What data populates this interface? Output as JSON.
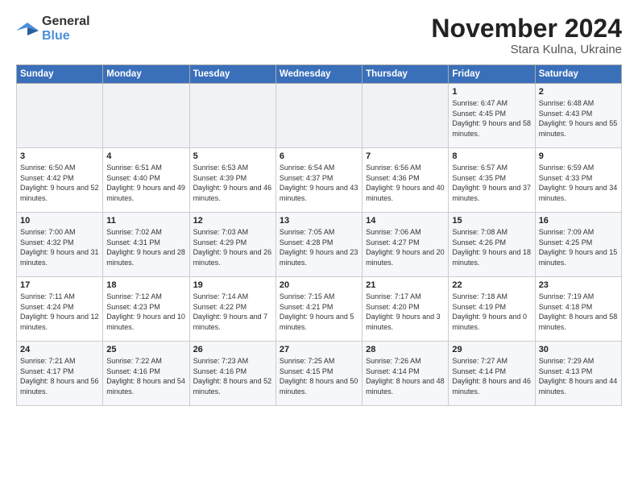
{
  "logo": {
    "general": "General",
    "blue": "Blue"
  },
  "title": "November 2024",
  "location": "Stara Kulna, Ukraine",
  "headers": [
    "Sunday",
    "Monday",
    "Tuesday",
    "Wednesday",
    "Thursday",
    "Friday",
    "Saturday"
  ],
  "weeks": [
    [
      {
        "day": "",
        "info": ""
      },
      {
        "day": "",
        "info": ""
      },
      {
        "day": "",
        "info": ""
      },
      {
        "day": "",
        "info": ""
      },
      {
        "day": "",
        "info": ""
      },
      {
        "day": "1",
        "info": "Sunrise: 6:47 AM\nSunset: 4:45 PM\nDaylight: 9 hours and 58 minutes."
      },
      {
        "day": "2",
        "info": "Sunrise: 6:48 AM\nSunset: 4:43 PM\nDaylight: 9 hours and 55 minutes."
      }
    ],
    [
      {
        "day": "3",
        "info": "Sunrise: 6:50 AM\nSunset: 4:42 PM\nDaylight: 9 hours and 52 minutes."
      },
      {
        "day": "4",
        "info": "Sunrise: 6:51 AM\nSunset: 4:40 PM\nDaylight: 9 hours and 49 minutes."
      },
      {
        "day": "5",
        "info": "Sunrise: 6:53 AM\nSunset: 4:39 PM\nDaylight: 9 hours and 46 minutes."
      },
      {
        "day": "6",
        "info": "Sunrise: 6:54 AM\nSunset: 4:37 PM\nDaylight: 9 hours and 43 minutes."
      },
      {
        "day": "7",
        "info": "Sunrise: 6:56 AM\nSunset: 4:36 PM\nDaylight: 9 hours and 40 minutes."
      },
      {
        "day": "8",
        "info": "Sunrise: 6:57 AM\nSunset: 4:35 PM\nDaylight: 9 hours and 37 minutes."
      },
      {
        "day": "9",
        "info": "Sunrise: 6:59 AM\nSunset: 4:33 PM\nDaylight: 9 hours and 34 minutes."
      }
    ],
    [
      {
        "day": "10",
        "info": "Sunrise: 7:00 AM\nSunset: 4:32 PM\nDaylight: 9 hours and 31 minutes."
      },
      {
        "day": "11",
        "info": "Sunrise: 7:02 AM\nSunset: 4:31 PM\nDaylight: 9 hours and 28 minutes."
      },
      {
        "day": "12",
        "info": "Sunrise: 7:03 AM\nSunset: 4:29 PM\nDaylight: 9 hours and 26 minutes."
      },
      {
        "day": "13",
        "info": "Sunrise: 7:05 AM\nSunset: 4:28 PM\nDaylight: 9 hours and 23 minutes."
      },
      {
        "day": "14",
        "info": "Sunrise: 7:06 AM\nSunset: 4:27 PM\nDaylight: 9 hours and 20 minutes."
      },
      {
        "day": "15",
        "info": "Sunrise: 7:08 AM\nSunset: 4:26 PM\nDaylight: 9 hours and 18 minutes."
      },
      {
        "day": "16",
        "info": "Sunrise: 7:09 AM\nSunset: 4:25 PM\nDaylight: 9 hours and 15 minutes."
      }
    ],
    [
      {
        "day": "17",
        "info": "Sunrise: 7:11 AM\nSunset: 4:24 PM\nDaylight: 9 hours and 12 minutes."
      },
      {
        "day": "18",
        "info": "Sunrise: 7:12 AM\nSunset: 4:23 PM\nDaylight: 9 hours and 10 minutes."
      },
      {
        "day": "19",
        "info": "Sunrise: 7:14 AM\nSunset: 4:22 PM\nDaylight: 9 hours and 7 minutes."
      },
      {
        "day": "20",
        "info": "Sunrise: 7:15 AM\nSunset: 4:21 PM\nDaylight: 9 hours and 5 minutes."
      },
      {
        "day": "21",
        "info": "Sunrise: 7:17 AM\nSunset: 4:20 PM\nDaylight: 9 hours and 3 minutes."
      },
      {
        "day": "22",
        "info": "Sunrise: 7:18 AM\nSunset: 4:19 PM\nDaylight: 9 hours and 0 minutes."
      },
      {
        "day": "23",
        "info": "Sunrise: 7:19 AM\nSunset: 4:18 PM\nDaylight: 8 hours and 58 minutes."
      }
    ],
    [
      {
        "day": "24",
        "info": "Sunrise: 7:21 AM\nSunset: 4:17 PM\nDaylight: 8 hours and 56 minutes."
      },
      {
        "day": "25",
        "info": "Sunrise: 7:22 AM\nSunset: 4:16 PM\nDaylight: 8 hours and 54 minutes."
      },
      {
        "day": "26",
        "info": "Sunrise: 7:23 AM\nSunset: 4:16 PM\nDaylight: 8 hours and 52 minutes."
      },
      {
        "day": "27",
        "info": "Sunrise: 7:25 AM\nSunset: 4:15 PM\nDaylight: 8 hours and 50 minutes."
      },
      {
        "day": "28",
        "info": "Sunrise: 7:26 AM\nSunset: 4:14 PM\nDaylight: 8 hours and 48 minutes."
      },
      {
        "day": "29",
        "info": "Sunrise: 7:27 AM\nSunset: 4:14 PM\nDaylight: 8 hours and 46 minutes."
      },
      {
        "day": "30",
        "info": "Sunrise: 7:29 AM\nSunset: 4:13 PM\nDaylight: 8 hours and 44 minutes."
      }
    ]
  ]
}
